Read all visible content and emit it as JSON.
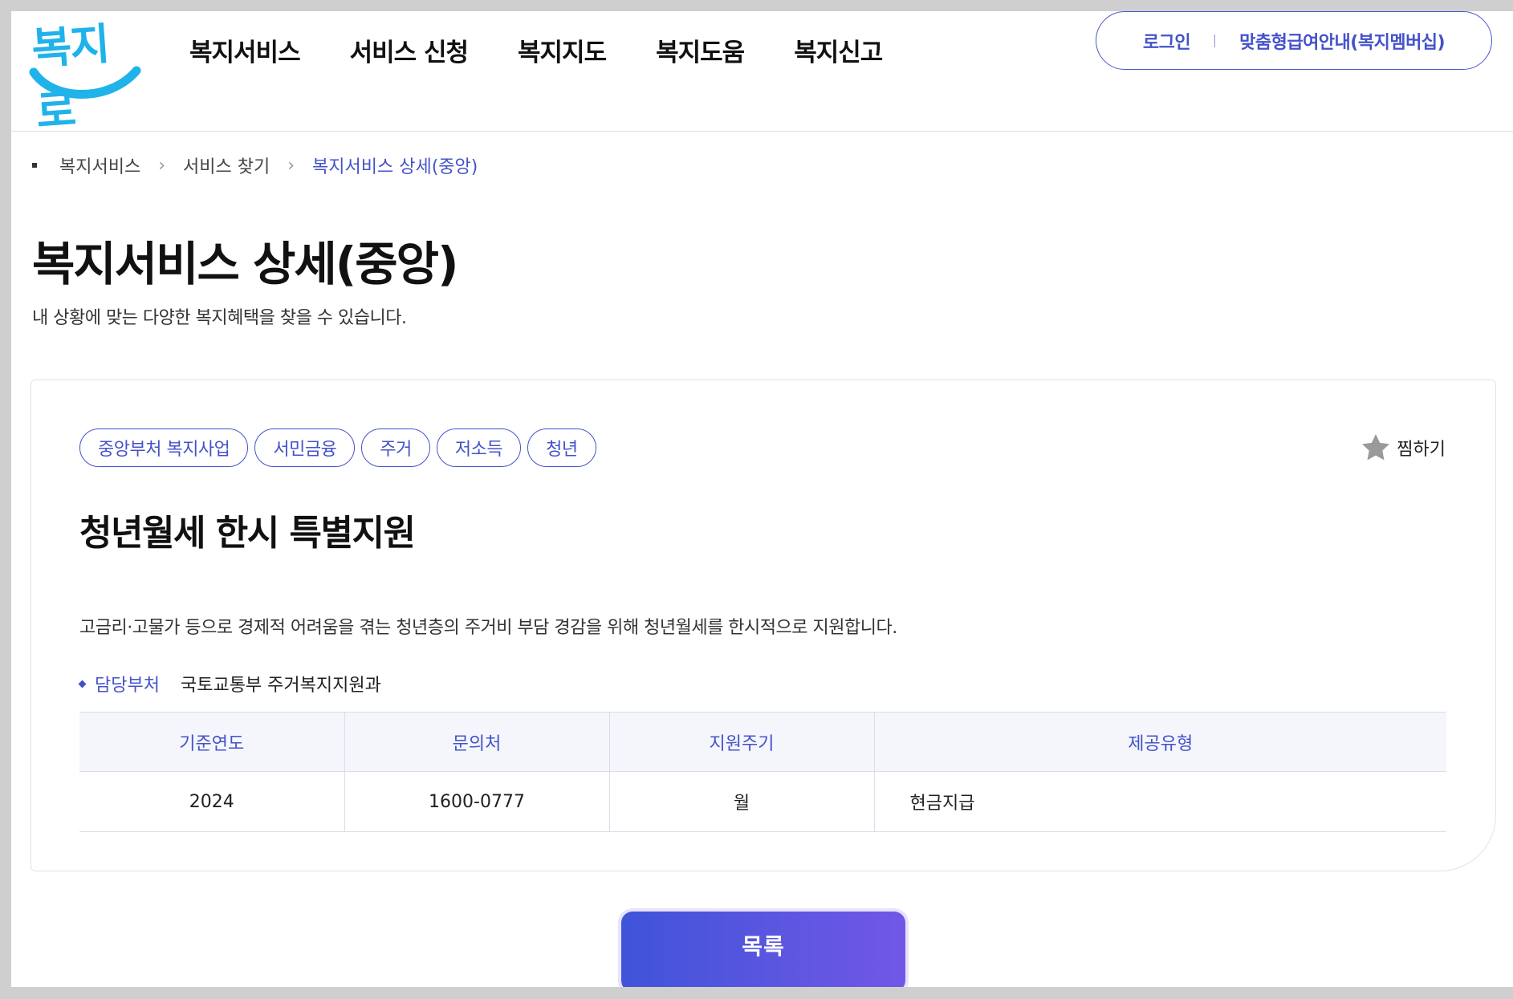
{
  "header": {
    "logo_text": "복지로",
    "nav": [
      "복지서비스",
      "서비스 신청",
      "복지지도",
      "복지도움",
      "복지신고"
    ],
    "login_label": "로그인",
    "membership_label": "맞춤형급여안내(복지멤버십)"
  },
  "breadcrumb": [
    "복지서비스",
    "서비스 찾기",
    "복지서비스 상세(중앙)"
  ],
  "page": {
    "title": "복지서비스 상세(중앙)",
    "description": "내 상황에 맞는 다양한 복지혜택을 찾을 수 있습니다."
  },
  "service": {
    "tags": [
      "중앙부처 복지사업",
      "서민금융",
      "주거",
      "저소득",
      "청년"
    ],
    "wish_label": "찜하기",
    "title": "청년월세 한시 특별지원",
    "description": "고금리·고물가 등으로 경제적 어려움을 겪는 청년층의 주거비 부담 경감을 위해 청년월세를 한시적으로 지원합니다.",
    "dept_label": "담당부처",
    "dept_value": "국토교통부 주거복지지원과",
    "table": {
      "headers": [
        "기준연도",
        "문의처",
        "지원주기",
        "제공유형"
      ],
      "row": [
        "2024",
        "1600-0777",
        "월",
        "현금지급"
      ]
    }
  },
  "buttons": {
    "list_label": "목록"
  },
  "colors": {
    "brand": "#4452c9",
    "logo": "#1fb3ea"
  }
}
